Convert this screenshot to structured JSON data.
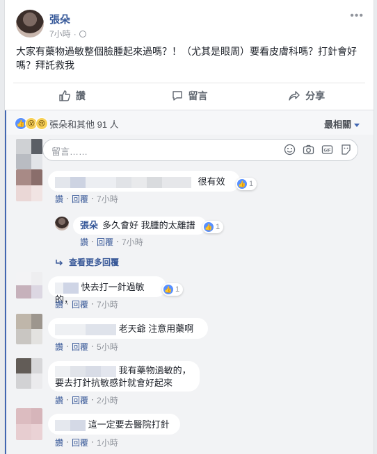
{
  "post": {
    "author": "張朵",
    "time": "7小時",
    "privacy_icon": "globe-icon",
    "text": "大家有藥物過敏整個臉腫起來過嗎？！（尤其是眼周）要看皮膚科嗎？打針會好嗎？拜託救我",
    "more_icon": "more-dots-icon",
    "more_glyph": "•••"
  },
  "actions": {
    "like": "讚",
    "comment": "留言",
    "share": "分享"
  },
  "reactions": {
    "summary": "張朵和其他 91 人",
    "sort_label": "最相關",
    "icons": [
      "like-icon",
      "wow-icon",
      "sad-icon"
    ]
  },
  "composer": {
    "placeholder": "留言……",
    "icons": [
      "emoji-icon",
      "camera-icon",
      "gif-icon",
      "sticker-icon"
    ]
  },
  "comments": [
    {
      "text": "很有效",
      "likes": "1",
      "time": "7小時"
    },
    {
      "text": "快去打一針過敏的，",
      "likes": "1",
      "time": "7小時"
    },
    {
      "text": "老天爺 注意用藥啊",
      "time": "5小時"
    },
    {
      "line1": "我有藥物過敏的，",
      "line2": "要去打針抗敏感針就會好起來",
      "time": "2小時"
    },
    {
      "text": "這一定要去醫院打針",
      "time": "1小時"
    }
  ],
  "reply": {
    "author": "張朵",
    "text": "多久會好 我腫的太離譜",
    "likes": "1",
    "time": "7小時"
  },
  "more_replies": "查看更多回覆",
  "comment_actions": {
    "like": "讚",
    "reply": "回覆",
    "sep": "·"
  },
  "colors": {
    "accent": "#4267b2",
    "link": "#385898",
    "like_blue": "#5890ff"
  }
}
